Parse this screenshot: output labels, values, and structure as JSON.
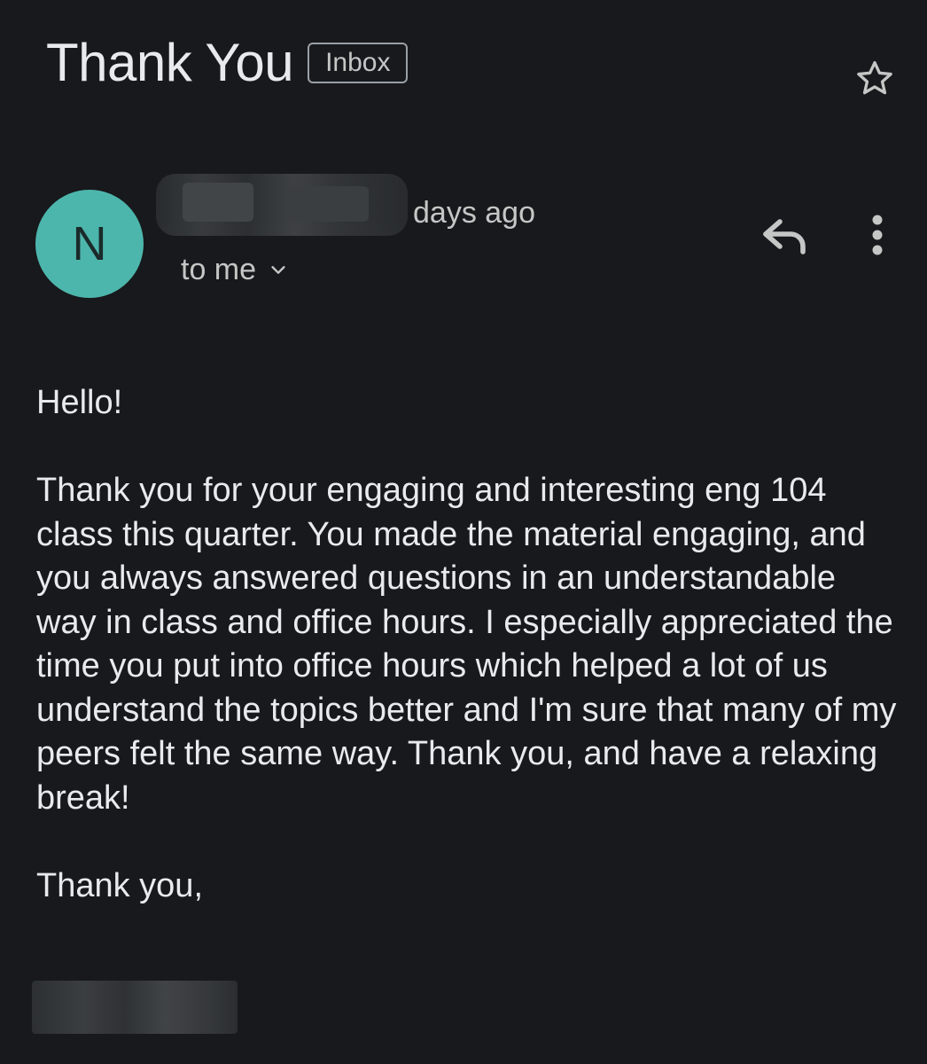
{
  "header": {
    "subject": "Thank You",
    "label": "Inbox",
    "star_icon": "star-outline-icon"
  },
  "message": {
    "avatar_letter": "N",
    "avatar_color": "#4db6ac",
    "date": "days ago",
    "recipients": "to me",
    "reply_icon": "reply-icon",
    "more_icon": "more-vert-icon"
  },
  "body": {
    "greeting": "Hello!",
    "paragraph": "Thank you for your engaging and interesting eng 104 class this quarter. You made the material engaging, and you always answered questions in an understandable way in class and office hours. I especially appreciated the time you put into office hours which helped a lot of us understand the topics better and I'm sure that many of my peers felt the same way. Thank you, and have a relaxing break!",
    "closing": "Thank you,"
  }
}
